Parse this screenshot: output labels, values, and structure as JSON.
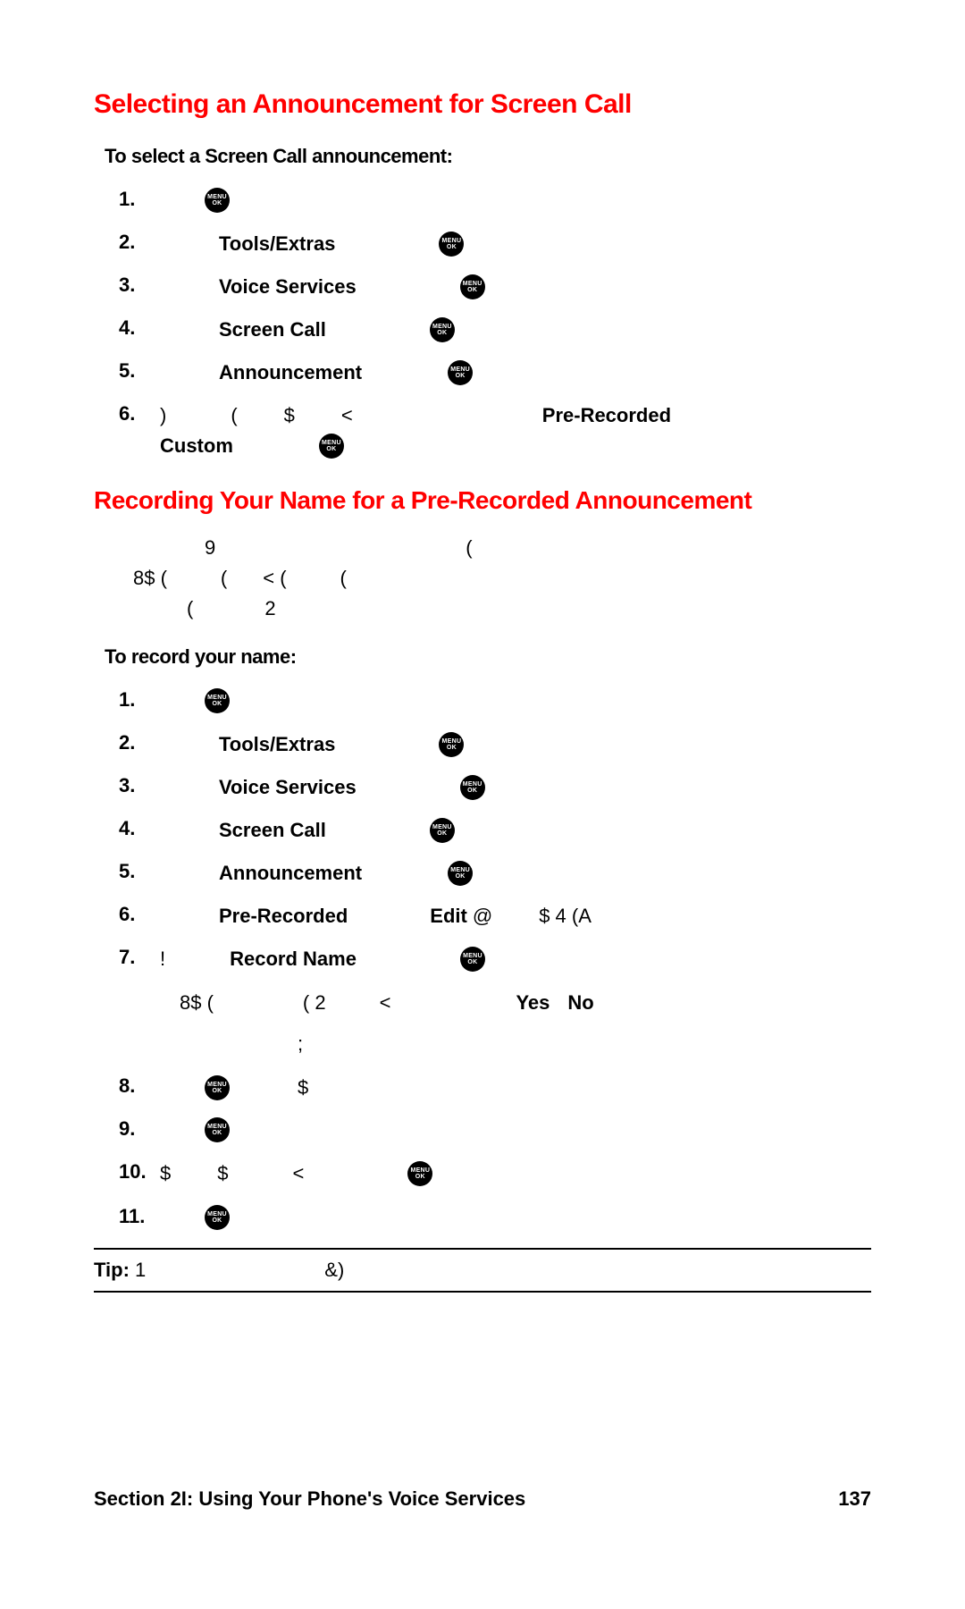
{
  "heading1": "Selecting an Announcement for Screen Call",
  "sub1": "To select a Screen Call announcement:",
  "listA": {
    "s1": "1.",
    "s2": "2.",
    "s2_label": "Tools/Extras",
    "s3": "3.",
    "s3_label": "Voice Services",
    "s4": "4.",
    "s4_label": "Screen Call",
    "s5": "5.",
    "s5_label": "Announcement",
    "s6": "6.",
    "s6_text_a": ")",
    "s6_text_b": "(",
    "s6_text_c": "$",
    "s6_text_d": "<",
    "s6_pre": "Pre-Recorded",
    "s6_custom": "Custom"
  },
  "heading2": "Recording Your Name for a Pre-Recorded Announcement",
  "para_line1a": "9",
  "para_line1b": "(",
  "para_line2a": "8$ (",
  "para_line2b": "(",
  "para_line2c": "< (",
  "para_line2d": "(",
  "para_line3a": "(",
  "para_line3b": "2",
  "sub2": "To record your name:",
  "listB": {
    "s1": "1.",
    "s2": "2.",
    "s2_label": "Tools/Extras",
    "s3": "3.",
    "s3_label": "Voice Services",
    "s4": "4.",
    "s4_label": "Screen Call",
    "s5": "5.",
    "s5_label": "Announcement",
    "s6": "6.",
    "s6_label": "Pre-Recorded",
    "s6_edit": "Edit",
    "s6_after": "@",
    "s6_tail": "$ 4 (A",
    "s7": "7.",
    "s7_pre": "!",
    "s7_label": "Record Name",
    "note1a": "8$ (",
    "note1b": "( 2",
    "note1c": "<",
    "note1_yes": "Yes",
    "note1_no": "No",
    "note2": ";",
    "s8": "8.",
    "s8_text": "$",
    "s9": "9.",
    "s10": "10.",
    "s10_a": "$",
    "s10_b": "$",
    "s10_c": "<",
    "s11": "11."
  },
  "tip_label": "Tip:",
  "tip_a": "1",
  "tip_b": "&)",
  "footer_left": "Section 2I: Using Your Phone's Voice Services",
  "footer_right": "137",
  "menu_top": "MENU",
  "menu_bot": "OK"
}
